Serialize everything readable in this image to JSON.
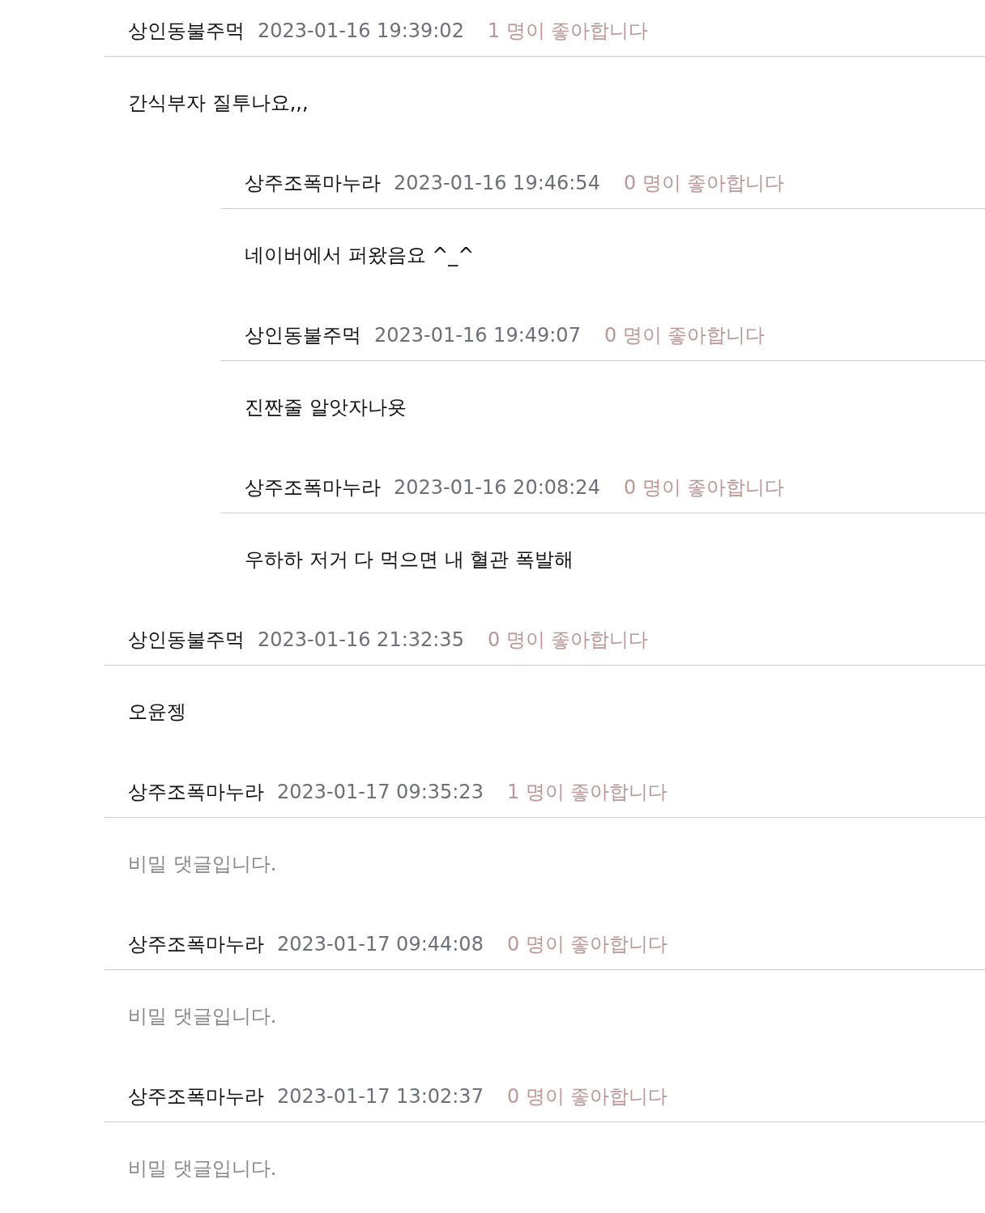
{
  "comments": [
    {
      "author": "상인동불주먹",
      "time": "2023-01-16 19:39:02",
      "likes": "1 명이 좋아합니다",
      "body": "간식부자 질투나요,,,",
      "secret": false,
      "replies": [
        {
          "author": "상주조폭마누라",
          "time": "2023-01-16 19:46:54",
          "likes": "0 명이 좋아합니다",
          "body": "네이버에서 퍼왔음요 ^_^",
          "secret": false
        },
        {
          "author": "상인동불주먹",
          "time": "2023-01-16 19:49:07",
          "likes": "0 명이 좋아합니다",
          "body": "진짠줄 알앗자나욧",
          "secret": false
        },
        {
          "author": "상주조폭마누라",
          "time": "2023-01-16 20:08:24",
          "likes": "0 명이 좋아합니다",
          "body": "우하하 저거 다 먹으면 내 혈관 폭발해",
          "secret": false
        }
      ]
    },
    {
      "author": "상인동불주먹",
      "time": "2023-01-16 21:32:35",
      "likes": "0 명이 좋아합니다",
      "body": "오윤젱",
      "secret": false
    },
    {
      "author": "상주조폭마누라",
      "time": "2023-01-17 09:35:23",
      "likes": "1 명이 좋아합니다",
      "body": "비밀 댓글입니다.",
      "secret": true
    },
    {
      "author": "상주조폭마누라",
      "time": "2023-01-17 09:44:08",
      "likes": "0 명이 좋아합니다",
      "body": "비밀 댓글입니다.",
      "secret": true
    },
    {
      "author": "상주조폭마누라",
      "time": "2023-01-17 13:02:37",
      "likes": "0 명이 좋아합니다",
      "body": "비밀 댓글입니다.",
      "secret": true
    }
  ]
}
